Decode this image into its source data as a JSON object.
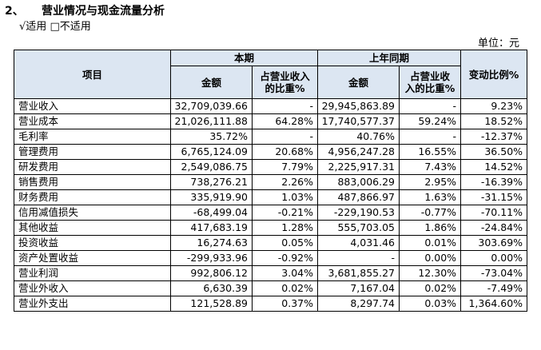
{
  "section": {
    "number": "2、",
    "title": "营业情况与现金流量分析"
  },
  "applicability": {
    "applicable": "√适用",
    "not_applicable": "□不适用"
  },
  "unit_label": "单位：元",
  "table": {
    "header": {
      "item": "项目",
      "current_period": "本期",
      "prior_period": "上年同期",
      "change": "变动比例%",
      "amount": "金额",
      "ratio_line1": "占营业收入",
      "ratio_line2": "的比重%",
      "prior_ratio_line1": "占营业收",
      "prior_ratio_line2": "入的比重%"
    },
    "rows": [
      [
        "营业收入",
        "32,709,039.66",
        "-",
        "29,945,863.89",
        "-",
        "9.23%"
      ],
      [
        "营业成本",
        "21,026,111.88",
        "64.28%",
        "17,740,577.37",
        "59.24%",
        "18.52%"
      ],
      [
        "毛利率",
        "35.72%",
        "-",
        "40.76%",
        "-",
        "-12.37%"
      ],
      [
        "管理费用",
        "6,765,124.09",
        "20.68%",
        "4,956,247.28",
        "16.55%",
        "36.50%"
      ],
      [
        "研发费用",
        "2,549,086.75",
        "7.79%",
        "2,225,917.31",
        "7.43%",
        "14.52%"
      ],
      [
        "销售费用",
        "738,276.21",
        "2.26%",
        "883,006.29",
        "2.95%",
        "-16.39%"
      ],
      [
        "财务费用",
        "335,919.90",
        "1.03%",
        "487,866.97",
        "1.63%",
        "-31.15%"
      ],
      [
        "信用减值损失",
        "-68,499.04",
        "-0.21%",
        "-229,190.53",
        "-0.77%",
        "-70.11%"
      ],
      [
        "其他收益",
        "417,683.19",
        "1.28%",
        "555,703.05",
        "1.86%",
        "-24.84%"
      ],
      [
        "投资收益",
        "16,274.63",
        "0.05%",
        "4,031.46",
        "0.01%",
        "303.69%"
      ],
      [
        "资产处置收益",
        "-299,933.96",
        "-0.92%",
        "-",
        "0.00%",
        "0.00%"
      ],
      [
        "营业利润",
        "992,806.12",
        "3.04%",
        "3,681,855.27",
        "12.30%",
        "-73.04%"
      ],
      [
        "营业外收入",
        "6,630.39",
        "0.02%",
        "7,167.04",
        "0.02%",
        "-7.49%"
      ],
      [
        "营业外支出",
        "121,528.89",
        "0.37%",
        "8,297.74",
        "0.03%",
        "1,364.60%"
      ]
    ]
  }
}
